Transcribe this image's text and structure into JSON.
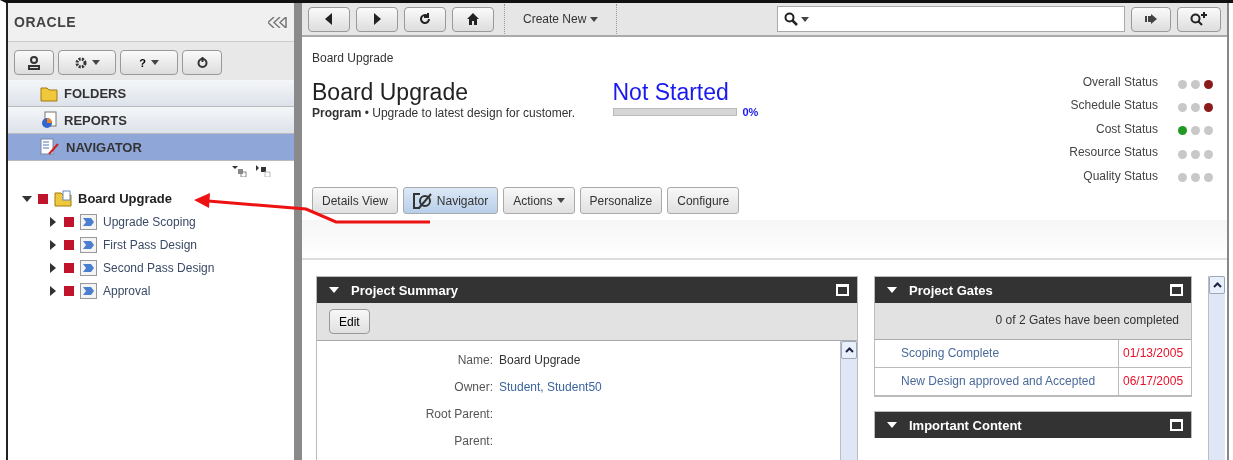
{
  "sidebar": {
    "logo": "ORACLE",
    "tool_buttons": [
      {
        "kind": "user"
      },
      {
        "kind": "gear",
        "dropdown": true
      },
      {
        "kind": "help",
        "label": "?",
        "dropdown": true
      },
      {
        "kind": "power"
      }
    ],
    "sections": [
      {
        "label": "FOLDERS",
        "kind": "folders",
        "selected": false
      },
      {
        "label": "REPORTS",
        "kind": "reports",
        "selected": false
      },
      {
        "label": "NAVIGATOR",
        "kind": "navigator",
        "selected": true
      }
    ],
    "tree": [
      {
        "label": "Board Upgrade",
        "kind": "program",
        "color": "#c0142c",
        "expanded": true,
        "children": [
          {
            "label": "Upgrade Scoping",
            "kind": "project",
            "color": "#c0142c",
            "expanded": false
          },
          {
            "label": "First Pass Design",
            "kind": "project",
            "color": "#c0142c",
            "expanded": false
          },
          {
            "label": "Second Pass Design",
            "kind": "project",
            "color": "#c0142c",
            "expanded": false
          },
          {
            "label": "Approval",
            "kind": "project",
            "color": "#c0142c",
            "expanded": false
          }
        ]
      }
    ]
  },
  "toolbar": {
    "create_new": "Create New"
  },
  "header": {
    "breadcrumb": "Board Upgrade",
    "title": "Board Upgrade",
    "type": "Program",
    "separator": "•",
    "description": "Upgrade to latest design for customer.",
    "state": "Not Started",
    "level": 0,
    "percent": "0%",
    "statuses": [
      {
        "label": "Overall Status",
        "dots": [
          {
            "color": "#c8c8c8"
          },
          {
            "color": "#c8c8c8"
          },
          {
            "color": "#8b1a1a"
          }
        ]
      },
      {
        "label": "Schedule Status",
        "dots": [
          {
            "color": "#c8c8c8"
          },
          {
            "color": "#c8c8c8"
          },
          {
            "color": "#8b1a1a"
          }
        ]
      },
      {
        "label": "Cost Status",
        "dots": [
          {
            "color": "#229922"
          },
          {
            "color": "#c8c8c8"
          },
          {
            "color": "#c8c8c8"
          }
        ]
      },
      {
        "label": "Resource Status",
        "dots": [
          {
            "color": "#c8c8c8"
          },
          {
            "color": "#c8c8c8"
          },
          {
            "color": "#c8c8c8"
          }
        ]
      },
      {
        "label": "Quality Status",
        "dots": [
          {
            "color": "#c8c8c8"
          },
          {
            "color": "#c8c8c8"
          },
          {
            "color": "#c8c8c8"
          }
        ]
      }
    ]
  },
  "view_buttons": [
    {
      "label": "Details View",
      "selected": false,
      "kind": "plain"
    },
    {
      "label": "Navigator",
      "selected": true,
      "kind": "icon"
    },
    {
      "label": "Actions",
      "selected": false,
      "kind": "dropdown"
    },
    {
      "label": "Personalize",
      "selected": false,
      "kind": "plain"
    },
    {
      "label": "Configure",
      "selected": false,
      "kind": "plain"
    }
  ],
  "project_summary": {
    "title": "Project Summary",
    "edit": "Edit",
    "fields": [
      {
        "label": "Name:",
        "value": "Board Upgrade",
        "kind": "text"
      },
      {
        "label": "Owner:",
        "value": "Student, Student50",
        "kind": "link"
      },
      {
        "label": "Root Parent:"
      },
      {
        "label": "Parent:"
      }
    ]
  },
  "project_gates": {
    "title": "Project Gates",
    "summary": "0 of 2 Gates have been completed",
    "gates": [
      {
        "name": "Scoping Complete",
        "date": "01/13/2005"
      },
      {
        "name": "New Design approved and Accepted",
        "date": "06/17/2005"
      }
    ]
  },
  "important_content": {
    "title": "Important Content"
  }
}
